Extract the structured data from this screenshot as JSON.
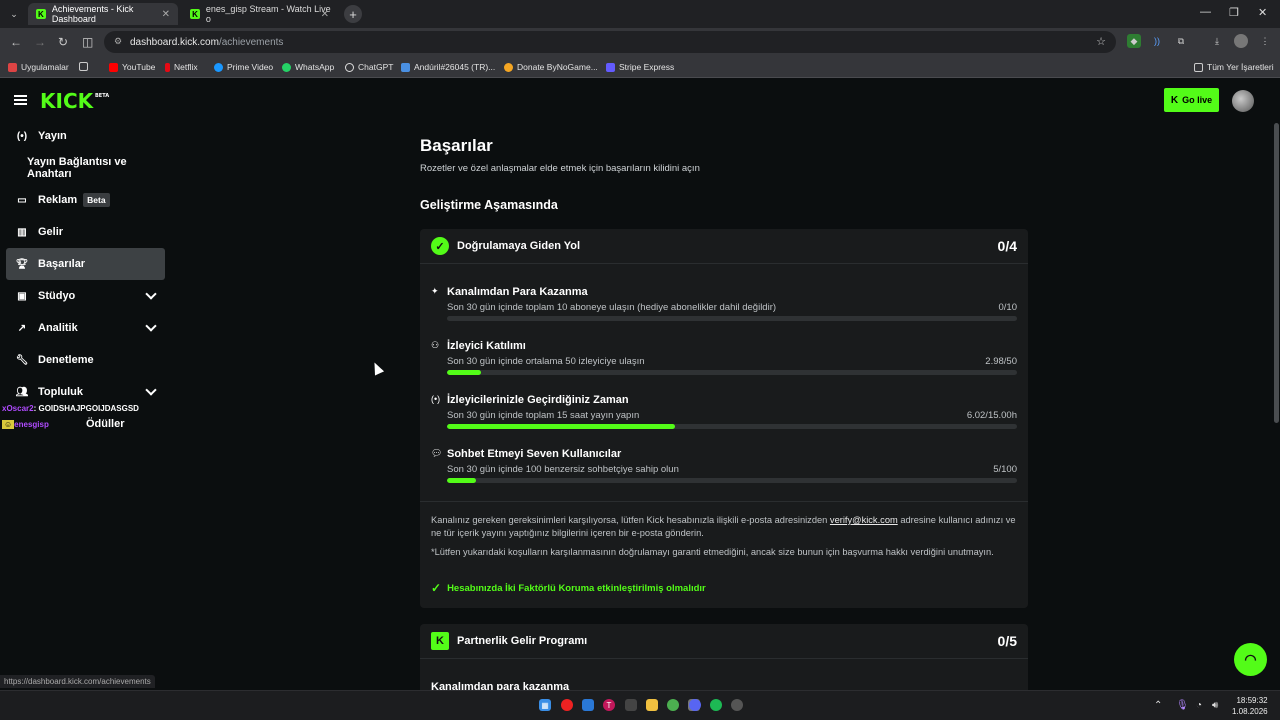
{
  "browser": {
    "tabs": [
      {
        "title": "Achievements - Kick Dashboard",
        "active": true
      },
      {
        "title": "enes_gisp Stream - Watch Live o",
        "active": false
      }
    ],
    "url_host": "dashboard.kick.com",
    "url_path": "/achievements",
    "bookmarks": [
      "Uygulamalar",
      "YouTube",
      "Netflix",
      "Prime Video",
      "WhatsApp",
      "ChatGPT",
      "Andúril#26045 (TR)...",
      "Donate ByNoGame...",
      "Stripe Express"
    ],
    "bookmarks_right": "Tüm Yer İşaretleri",
    "status_url": "https://dashboard.kick.com/achievements"
  },
  "header": {
    "logo": "KICK",
    "logo_badge": "BETA",
    "go_live": "Go live"
  },
  "sidebar": {
    "items": [
      {
        "label": "Yayın",
        "icon": "broadcast-icon"
      },
      {
        "label": "Yayın Bağlantısı ve Anahtarı",
        "icon": ""
      },
      {
        "label": "Reklam",
        "icon": "ad-icon",
        "badge": "Beta"
      },
      {
        "label": "Gelir",
        "icon": "chart-icon"
      },
      {
        "label": "Başarılar",
        "icon": "trophy-icon",
        "active": true
      },
      {
        "label": "Stüdyo",
        "icon": "studio-icon",
        "expandable": true
      },
      {
        "label": "Analitik",
        "icon": "analytics-icon",
        "expandable": true
      },
      {
        "label": "Denetleme",
        "icon": "wrench-icon"
      },
      {
        "label": "Topluluk",
        "icon": "community-icon",
        "expandable": true
      },
      {
        "label": "Ödüller",
        "icon": ""
      }
    ],
    "overlay_chat": [
      {
        "user": "xOscar2",
        "text": ": GOIDSHAJPGOIJDASGSD"
      },
      {
        "user": "enesgisp",
        "text": ""
      }
    ]
  },
  "main": {
    "title": "Başarılar",
    "subtitle": "Rozetler ve özel anlaşmalar elde etmek için başarıların kilidini açın",
    "section": "Geliştirme Aşamasında",
    "cards": [
      {
        "title": "Doğrulamaya Giden Yol",
        "count": "0/4",
        "goals": [
          {
            "icon": "sparkle-icon",
            "title": "Kanalımdan Para Kazanma",
            "desc": "Son 30 gün içinde toplam 10 aboneye ulaşın (hediye abonelikler dahil değildir)",
            "value": "0/10",
            "progress": 0
          },
          {
            "icon": "viewers-icon",
            "title": "İzleyici Katılımı",
            "desc": "Son 30 gün içinde ortalama 50 izleyiciye ulaşın",
            "value": "2.98/50",
            "progress": 0.06
          },
          {
            "icon": "broadcast-icon",
            "title": "İzleyicilerinizle Geçirdiğiniz Zaman",
            "desc": "Son 30 gün içinde toplam 15 saat yayın yapın",
            "value": "6.02/15.00h",
            "progress": 0.4
          },
          {
            "icon": "chat-icon",
            "title": "Sohbet Etmeyi Seven Kullanıcılar",
            "desc": "Son 30 gün içinde 100 benzersiz sohbetçiye sahip olun",
            "value": "5/100",
            "progress": 0.05
          }
        ],
        "note_pre": "Kanalınız gereken gereksinimleri karşılıyorsa, lütfen Kick hesabınızla ilişkili e-posta adresinizden ",
        "note_link": "verify@kick.com",
        "note_post": " adresine kullanıcı adınızı ve ne tür içerik yayını yaptığınız bilgilerini içeren bir e-posta gönderin.",
        "note2": "*Lütfen yukarıdaki koşulların karşılanmasının doğrulamayı garanti etmediğini, ancak size bunun için başvurma hakkı verdiğini unutmayın.",
        "check": "Hesabınızda İki Faktörlü Koruma etkinleştirilmiş olmalıdır"
      },
      {
        "title": "Partnerlik Gelir Programı",
        "count": "0/5",
        "peek_goal": "Kanalımdan para kazanma"
      }
    ]
  },
  "taskbar": {
    "time": "18:59:32",
    "date": "1.08.2026"
  },
  "colors": {
    "accent": "#53fc18",
    "bg": "#0b0e0f",
    "card": "#191b1c"
  }
}
